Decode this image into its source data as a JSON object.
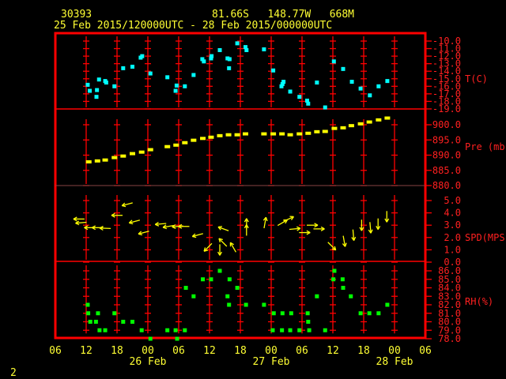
{
  "header": {
    "station_id": "30393",
    "location": "81.66S   148.77W   668M",
    "time_range": "25 Feb 2015/120000UTC - 28 Feb 2015/000000UTC"
  },
  "footer": {
    "page_number": "2"
  },
  "x_axis": {
    "units": "hours since 25 Feb 2015 06 UTC",
    "range": [
      0,
      72
    ],
    "tick_labels": [
      "06",
      "12",
      "18",
      "00",
      "06",
      "12",
      "18",
      "00",
      "06",
      "12",
      "18",
      "00",
      "06"
    ],
    "date_labels": [
      {
        "text": "26 Feb",
        "hour": 18
      },
      {
        "text": "27 Feb",
        "hour": 42
      },
      {
        "text": "28 Feb",
        "hour": 66
      }
    ]
  },
  "colors": {
    "frame": "#ff0000",
    "temperature": "#00ffff",
    "pressure": "#ffff00",
    "wind": "#ffff00",
    "rh": "#00ff00",
    "text": "#ffff33"
  },
  "chart_data": [
    {
      "type": "scatter",
      "name": "temperature",
      "ylabel": "T(C)",
      "ylim": [
        -19,
        -10
      ],
      "tick_labels": [
        "-10.0",
        "-11.0",
        "-12.0",
        "-13.0",
        "-14.0",
        "-15.0",
        "-16.0",
        "-17.0",
        "-18.0",
        "-19.0"
      ],
      "tick_values": [
        -10,
        -11,
        -12,
        -13,
        -14,
        -15,
        -16,
        -17,
        -18,
        -19
      ],
      "points": [
        [
          6.3,
          -15.8
        ],
        [
          6.7,
          -16.6
        ],
        [
          8,
          -17.4
        ],
        [
          8.1,
          -16.5
        ],
        [
          8.5,
          -15.1
        ],
        [
          9.7,
          -15.3
        ],
        [
          9.9,
          -15.5
        ],
        [
          11.5,
          -16.0
        ],
        [
          13.2,
          -13.6
        ],
        [
          15,
          -13.4
        ],
        [
          16.6,
          -12.2
        ],
        [
          16.9,
          -12.0
        ],
        [
          18.5,
          -14.3
        ],
        [
          21.8,
          -14.8
        ],
        [
          23.4,
          -16.6
        ],
        [
          23.6,
          -15.9
        ],
        [
          25.2,
          -16.0
        ],
        [
          26.9,
          -14.5
        ],
        [
          28.6,
          -12.4
        ],
        [
          28.9,
          -12.7
        ],
        [
          30.3,
          -12.3
        ],
        [
          30.4,
          -12.0
        ],
        [
          32,
          -11.2
        ],
        [
          33.5,
          -12.3
        ],
        [
          33.8,
          -13.6
        ],
        [
          33.9,
          -12.4
        ],
        [
          35.4,
          -10.3
        ],
        [
          37.0,
          -10.8
        ],
        [
          37.2,
          -11.2
        ],
        [
          40.6,
          -11.1
        ],
        [
          42.4,
          -13.9
        ],
        [
          44,
          -16.0
        ],
        [
          44.2,
          -15.7
        ],
        [
          44.4,
          -15.4
        ],
        [
          45.7,
          -16.7
        ],
        [
          47.5,
          -17.4
        ],
        [
          49,
          -17.9
        ],
        [
          49.2,
          -18.3
        ],
        [
          50.9,
          -15.5
        ],
        [
          52.5,
          -18.8
        ],
        [
          54.2,
          -12.7
        ],
        [
          56,
          -13.7
        ],
        [
          57.7,
          -15.4
        ],
        [
          59.4,
          -16.3
        ],
        [
          61.2,
          -17.2
        ],
        [
          62.9,
          -16.0
        ],
        [
          64.6,
          -15.3
        ]
      ]
    },
    {
      "type": "scatter",
      "name": "pressure",
      "ylabel": "Pre (mb)",
      "ylim": [
        880,
        904
      ],
      "tick_labels": [
        "900.0",
        "895.0",
        "890.0",
        "885.0",
        "880.0"
      ],
      "tick_values": [
        900,
        895,
        890,
        885,
        880
      ],
      "points": [
        [
          6.5,
          887.8
        ],
        [
          8.2,
          888.1
        ],
        [
          9.7,
          888.4
        ],
        [
          11.5,
          889.2
        ],
        [
          13.2,
          889.7
        ],
        [
          15,
          890.5
        ],
        [
          16.8,
          891.0
        ],
        [
          18.5,
          891.8
        ],
        [
          21.8,
          892.8
        ],
        [
          23.5,
          893.3
        ],
        [
          25.2,
          894.1
        ],
        [
          26.9,
          894.9
        ],
        [
          28.7,
          895.5
        ],
        [
          30.3,
          895.9
        ],
        [
          32,
          896.4
        ],
        [
          33.7,
          896.7
        ],
        [
          35.4,
          896.7
        ],
        [
          37,
          897.0
        ],
        [
          40.6,
          897.0
        ],
        [
          42.4,
          897.0
        ],
        [
          44.1,
          897.0
        ],
        [
          45.7,
          896.7
        ],
        [
          47.5,
          897.0
        ],
        [
          49.2,
          897.2
        ],
        [
          50.9,
          897.7
        ],
        [
          52.5,
          897.8
        ],
        [
          54.3,
          898.8
        ],
        [
          56,
          899.0
        ],
        [
          57.6,
          899.7
        ],
        [
          59.4,
          900.3
        ],
        [
          61.1,
          900.9
        ],
        [
          62.9,
          901.6
        ],
        [
          64.6,
          902.2
        ]
      ]
    },
    {
      "type": "vector",
      "name": "wind_speed",
      "ylabel": "SPD(MPS)",
      "ylim": [
        0,
        5
      ],
      "tick_labels": [
        "5.0",
        "4.0",
        "3.0",
        "2.0",
        "1.0",
        "0.0"
      ],
      "tick_values": [
        5,
        4,
        3,
        2,
        1,
        0
      ],
      "point_format": "[hour, speed_mps, arrow_heading_deg (0=east,90=north)]",
      "points": [
        [
          4.6,
          3.5,
          180
        ],
        [
          5,
          3.2,
          185
        ],
        [
          6.7,
          2.8,
          180
        ],
        [
          8.2,
          2.8,
          180
        ],
        [
          9.7,
          2.75,
          178
        ],
        [
          12,
          3.8,
          180
        ],
        [
          14,
          4.7,
          195
        ],
        [
          15.4,
          3.3,
          195
        ],
        [
          17.2,
          2.4,
          195
        ],
        [
          20.5,
          3.1,
          185
        ],
        [
          22,
          2.9,
          190
        ],
        [
          23.8,
          2.9,
          185
        ],
        [
          25,
          2.9,
          180
        ],
        [
          27.7,
          2.2,
          195
        ],
        [
          29.7,
          1.2,
          225
        ],
        [
          32,
          1.0,
          270
        ],
        [
          32.6,
          1.6,
          135
        ],
        [
          32.7,
          2.7,
          160
        ],
        [
          34.6,
          1.2,
          120
        ],
        [
          37.2,
          3.1,
          90
        ],
        [
          37.2,
          2.6,
          90
        ],
        [
          40.8,
          3.2,
          80
        ],
        [
          44.2,
          3.2,
          30
        ],
        [
          45.4,
          3.5,
          25
        ],
        [
          46.6,
          2.7,
          5
        ],
        [
          48.5,
          2.4,
          0
        ],
        [
          50,
          3.0,
          0
        ],
        [
          51.3,
          2.7,
          0
        ],
        [
          53.8,
          1.3,
          315
        ],
        [
          56.2,
          1.7,
          280
        ],
        [
          58,
          2.2,
          275
        ],
        [
          59.6,
          3.0,
          270
        ],
        [
          61.3,
          2.8,
          275
        ],
        [
          62.8,
          3.1,
          270
        ],
        [
          64.5,
          3.7,
          270
        ]
      ]
    },
    {
      "type": "scatter",
      "name": "relative_humidity",
      "ylabel": "RH(%)",
      "ylim": [
        78,
        86
      ],
      "tick_labels": [
        "86.0",
        "85.0",
        "84.0",
        "83.0",
        "82.0",
        "81.0",
        "80.0",
        "79.0",
        "78.0"
      ],
      "tick_values": [
        86,
        85,
        84,
        83,
        82,
        81,
        80,
        79,
        78
      ],
      "points": [
        [
          6.3,
          82
        ],
        [
          6.4,
          81
        ],
        [
          6.8,
          80
        ],
        [
          7.9,
          80
        ],
        [
          8.3,
          81
        ],
        [
          8.6,
          79
        ],
        [
          9.7,
          79
        ],
        [
          11.5,
          81
        ],
        [
          13.2,
          80
        ],
        [
          15,
          80
        ],
        [
          16.8,
          79
        ],
        [
          18.5,
          78
        ],
        [
          21.8,
          79
        ],
        [
          23.4,
          79
        ],
        [
          23.7,
          78
        ],
        [
          25.2,
          79
        ],
        [
          25.4,
          84
        ],
        [
          26.9,
          83
        ],
        [
          28.7,
          85
        ],
        [
          30.3,
          85
        ],
        [
          32,
          86
        ],
        [
          33.5,
          83
        ],
        [
          33.8,
          82
        ],
        [
          33.9,
          85
        ],
        [
          35.4,
          84
        ],
        [
          37.1,
          82
        ],
        [
          40.6,
          82
        ],
        [
          42.3,
          79
        ],
        [
          42.5,
          81
        ],
        [
          44.1,
          79
        ],
        [
          44.2,
          81
        ],
        [
          45.7,
          79
        ],
        [
          45.9,
          81
        ],
        [
          47.5,
          79
        ],
        [
          49.1,
          81
        ],
        [
          49.2,
          80
        ],
        [
          49.4,
          79
        ],
        [
          50.9,
          83
        ],
        [
          52.5,
          79
        ],
        [
          54.3,
          86
        ],
        [
          54.1,
          85
        ],
        [
          55.9,
          85
        ],
        [
          56,
          84
        ],
        [
          57.5,
          83
        ],
        [
          59.4,
          81
        ],
        [
          61.1,
          81
        ],
        [
          62.9,
          81
        ],
        [
          64.6,
          82
        ]
      ]
    }
  ]
}
